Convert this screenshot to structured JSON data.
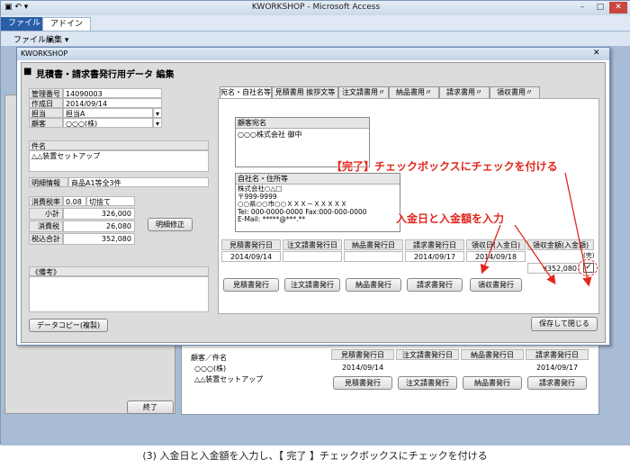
{
  "app": {
    "title": "KWORKSHOP - Microsoft Access",
    "tabs": [
      "ファイル",
      "アドイン"
    ],
    "menus": [
      "ファイル ▾",
      "編集 ▾"
    ],
    "minimize": "–",
    "restore": "□",
    "close": "✕"
  },
  "dialog": {
    "window_title": "KWORKSHOP",
    "form_title": "見積書・請求書発行用データ 編集",
    "close": "✕"
  },
  "left": {
    "mgmt_label": "管理番号",
    "mgmt_value": "14090003",
    "date_label": "作成日",
    "date_value": "2014/09/14",
    "person_label": "担当",
    "person_value": "担当A",
    "customer_label": "顧客",
    "customer_value": "○○○(株)",
    "subject_label": "件名",
    "subject_value": "△△装置セットアップ",
    "detail_label": "明細情報",
    "detail_value": "商品A1等全3件",
    "tax_label": "消費税率",
    "tax_rate": "0.08",
    "tax_rounding": "切捨て",
    "subtotal_label": "小計",
    "subtotal_value": "326,000",
    "tax_amount_label": "消費税",
    "tax_amount_value": "26,080",
    "total_label": "税込合計",
    "total_value": "352,080",
    "detail_edit_button": "明細修正",
    "remarks_label": "《備考》",
    "copy_button": "データコピー(複製)"
  },
  "tabs": [
    "宛名・自社名等",
    "見積書用 挨拶文等",
    "注文請書用〃",
    "納品書用〃",
    "請求書用〃",
    "領収書用〃"
  ],
  "address": {
    "customer_header": "顧客宛名",
    "customer_name": "○○○株式会社 御中",
    "company_header": "自社名・住所等",
    "company_lines": [
      "株式会社○△□",
      "〒999-9999",
      "○○県○○市○○ＸＸＸ－ＸＸＸＸＸ",
      "Tel: 000-0000-0000 Fax:000-000-0000",
      "E-Mail: *****@***.**"
    ]
  },
  "issue": {
    "headers": [
      "見積書発行日",
      "注文請書発行日",
      "納品書発行日",
      "請求書発行日",
      "領収日(入金日)",
      "領収金額(入金額)"
    ],
    "dates": [
      "2014/09/14",
      "",
      "",
      "2014/09/17",
      "2014/09/18",
      "¥352,080"
    ],
    "buttons": [
      "見積書発行",
      "注文請書発行",
      "納品書発行",
      "請求書発行",
      "領収書発行"
    ],
    "complete_label": "(完)"
  },
  "save_button": "保存して閉じる",
  "annotations": {
    "checkbox": "【完了】チェックボックスにチェックを付ける",
    "payment": "入金日と入金額を入力"
  },
  "background": {
    "header": "顧客／件名",
    "customer": "○○○(株)",
    "subject": "△△装置セットアップ",
    "dates": [
      "2014/09/14",
      "2014/09/17"
    ],
    "buttons": [
      "見積書発行",
      "注文請書発行",
      "納品書発行",
      "請求書発行"
    ],
    "headers": [
      "見積書発行日",
      "注文請書発行日",
      "納品書発行日",
      "請求書発行日"
    ],
    "close_button": "終了"
  },
  "caption": "(3) 入金日と入金額を入力し、【 完了 】チェックボックスにチェックを付ける"
}
